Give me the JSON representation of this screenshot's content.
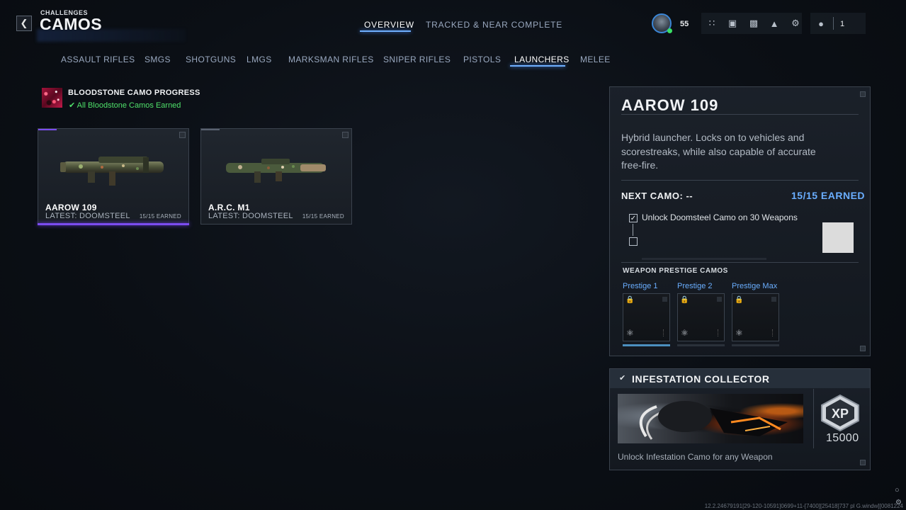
{
  "header": {
    "breadcrumb": "CHALLENGES",
    "title": "CAMOS",
    "back_icon": "chevron-left-icon",
    "tabs": [
      {
        "label": "OVERVIEW",
        "active": true
      },
      {
        "label": "TRACKED & NEAR COMPLETE",
        "active": false
      }
    ],
    "player_level": "55",
    "party_count": "1",
    "tray_icons": [
      "apps-grid-icon",
      "store-icon",
      "camera-icon",
      "notification-bell-icon",
      "settings-gear-icon"
    ],
    "party_icon": "party-icon"
  },
  "categories": [
    {
      "label": "ASSAULT RIFLES",
      "active": false
    },
    {
      "label": "SMGS",
      "active": false
    },
    {
      "label": "SHOTGUNS",
      "active": false
    },
    {
      "label": "LMGS",
      "active": false
    },
    {
      "label": "MARKSMAN RIFLES",
      "active": false
    },
    {
      "label": "SNIPER RIFLES",
      "active": false
    },
    {
      "label": "PISTOLS",
      "active": false
    },
    {
      "label": "LAUNCHERS",
      "active": true
    },
    {
      "label": "MELEE",
      "active": false
    }
  ],
  "bloodstone": {
    "title": "BLOODSTONE CAMO PROGRESS",
    "status": "All Bloodstone Camos Earned",
    "status_color": "#4fe06a"
  },
  "weapons": [
    {
      "name": "AAROW 109",
      "latest": "LATEST: DOOMSTEEL",
      "earned": "15/15 EARNED",
      "selected": true
    },
    {
      "name": "A.R.C. M1",
      "latest": "LATEST: DOOMSTEEL",
      "earned": "15/15 EARNED",
      "selected": false
    }
  ],
  "detail": {
    "title": "AAROW 109",
    "description": "Hybrid launcher. Locks on to vehicles and scorestreaks, while also capable of accurate free-fire.",
    "next_camo": "NEXT CAMO: --",
    "earned": "15/15 EARNED",
    "challenge": "Unlock Doomsteel Camo on 30 Weapons",
    "prestige_header": "WEAPON PRESTIGE CAMOS",
    "prestige": [
      {
        "label": "Prestige 1",
        "progress": 1.0
      },
      {
        "label": "Prestige 2",
        "progress": 0
      },
      {
        "label": "Prestige Max",
        "progress": 0
      }
    ]
  },
  "infestation": {
    "title": "INFESTATION COLLECTOR",
    "xp_label": "XP",
    "xp_amount": "15000",
    "description": "Unlock Infestation Camo for any Weapon"
  },
  "footer": "12.2.24679191[29-120-10591]0699+11-[7400][25418]737 pl G.windw][0081224"
}
